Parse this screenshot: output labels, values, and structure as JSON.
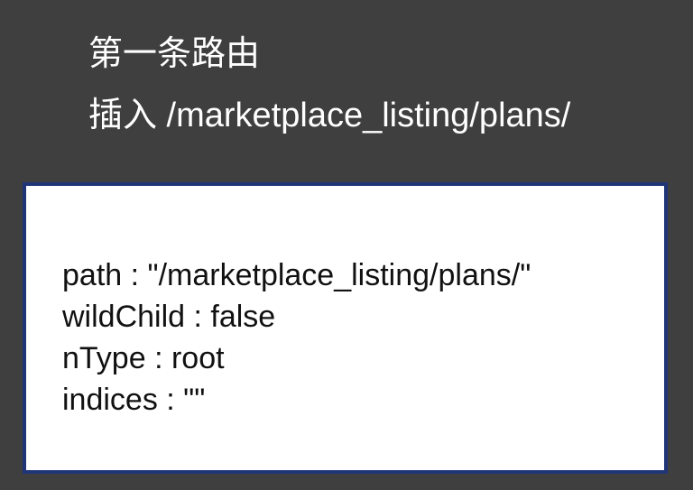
{
  "slide": {
    "title": "第一条路由",
    "subtitle": "插入 /marketplace_listing/plans/"
  },
  "node": {
    "fields": [
      "path : \"/marketplace_listing/plans/\"",
      "wildChild : false",
      "nType : root",
      "indices : \"\""
    ]
  },
  "colors": {
    "background": "#3f3f3f",
    "box_border": "#1f3577",
    "box_fill": "#ffffff"
  }
}
